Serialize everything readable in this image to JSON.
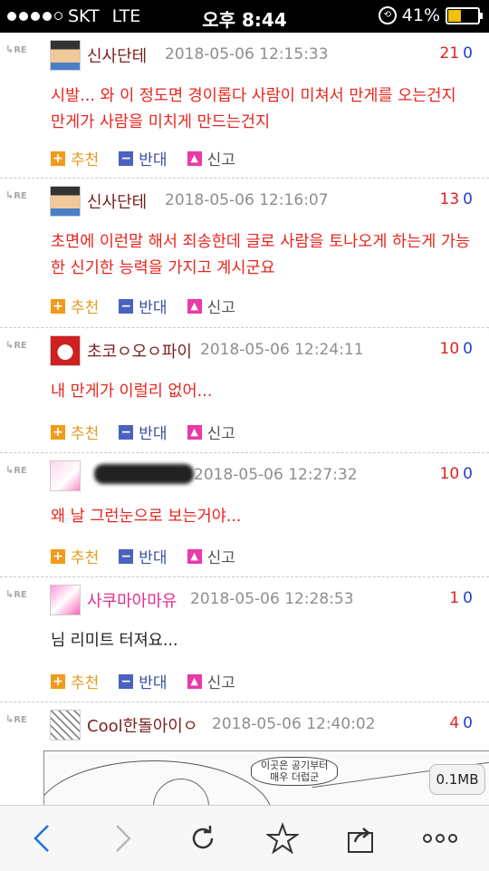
{
  "status_bar": {
    "carrier": "SKT",
    "network": "LTE",
    "time": "오후 8:44",
    "battery": "41%",
    "battery_level": 0.41,
    "signal_bars_filled": 4
  },
  "comments": [
    {
      "reply_marker": "RE",
      "nickname": "신사단테",
      "timestamp": "2018-05-06 12:15:33",
      "upvotes": "21",
      "downvotes": "0",
      "text": "시발... 와 이 정도면 경이롭다 사람이 미쳐서 만게를 오는건지 만게가 사람을 미치게 만드는건지",
      "recommend": "추천",
      "oppose": "반대",
      "report": "신고"
    },
    {
      "reply_marker": "RE",
      "nickname": "신사단테",
      "timestamp": "2018-05-06 12:16:07",
      "upvotes": "13",
      "downvotes": "0",
      "text": "초면에 이런말 해서 죄송한데 글로 사람을 토나오게 하는게 가능한 신기한 능력을 가지고 계시군요",
      "recommend": "추천",
      "oppose": "반대",
      "report": "신고"
    },
    {
      "reply_marker": "RE",
      "nickname": "초코ㅇ오ㅇ파이",
      "timestamp": "2018-05-06 12:24:11",
      "upvotes": "10",
      "downvotes": "0",
      "text": "내 만게가 이럴리 없어...",
      "recommend": "추천",
      "oppose": "반대",
      "report": "신고"
    },
    {
      "reply_marker": "RE",
      "nickname": "",
      "timestamp": "2018-05-06 12:27:32",
      "upvotes": "10",
      "downvotes": "0",
      "text": "왜 날 그런눈으로 보는거야...",
      "recommend": "추천",
      "oppose": "반대",
      "report": "신고"
    },
    {
      "reply_marker": "RE",
      "nickname": "사쿠마아마유",
      "timestamp": "2018-05-06 12:28:53",
      "upvotes": "1",
      "downvotes": "0",
      "text": "님 리미트 터져요...",
      "recommend": "추천",
      "oppose": "반대",
      "report": "신고"
    },
    {
      "reply_marker": "RE",
      "nickname": "Cool한돌아이ㅇ",
      "timestamp": "2018-05-06 12:40:02",
      "upvotes": "4",
      "downvotes": "0"
    }
  ],
  "image_attachment": {
    "speech_bubble": "이곳은 공기부터\n매우 더럽군",
    "file_size": "0.1MB"
  },
  "toolbar": {
    "icons": [
      "back-icon",
      "forward-icon",
      "reload-icon",
      "bookmark-star-icon",
      "share-icon",
      "more-icon"
    ]
  },
  "colors": {
    "comment_text": "#e8241e",
    "upvote": "#e02020",
    "downvote": "#2040d0",
    "recommend": "#f29a1a",
    "oppose": "#4a62c0",
    "report": "#e83aa8"
  }
}
